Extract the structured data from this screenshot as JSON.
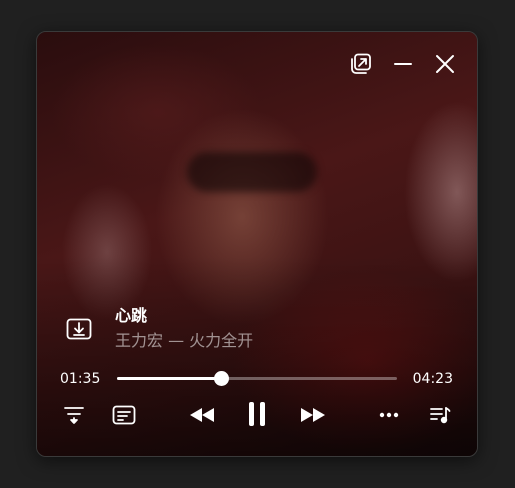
{
  "track": {
    "title": "心跳",
    "artist_album": "王力宏 — 火力全开"
  },
  "playback": {
    "current_time": "01:35",
    "total_time": "04:23",
    "progress": 0.37,
    "state": "playing"
  },
  "icons": {
    "pip": "picture-in-picture-icon",
    "minimize": "minimize-icon",
    "close": "close-icon",
    "download": "download-icon",
    "equalizer": "equalizer-icon",
    "lyrics": "lyrics-icon",
    "previous": "previous-icon",
    "pause": "pause-icon",
    "next": "next-icon",
    "more": "more-icon",
    "playlist": "playlist-icon"
  },
  "colors": {
    "background": "#202020",
    "foreground": "#ffffff",
    "muted_text": "rgba(255,255,255,0.55)"
  }
}
